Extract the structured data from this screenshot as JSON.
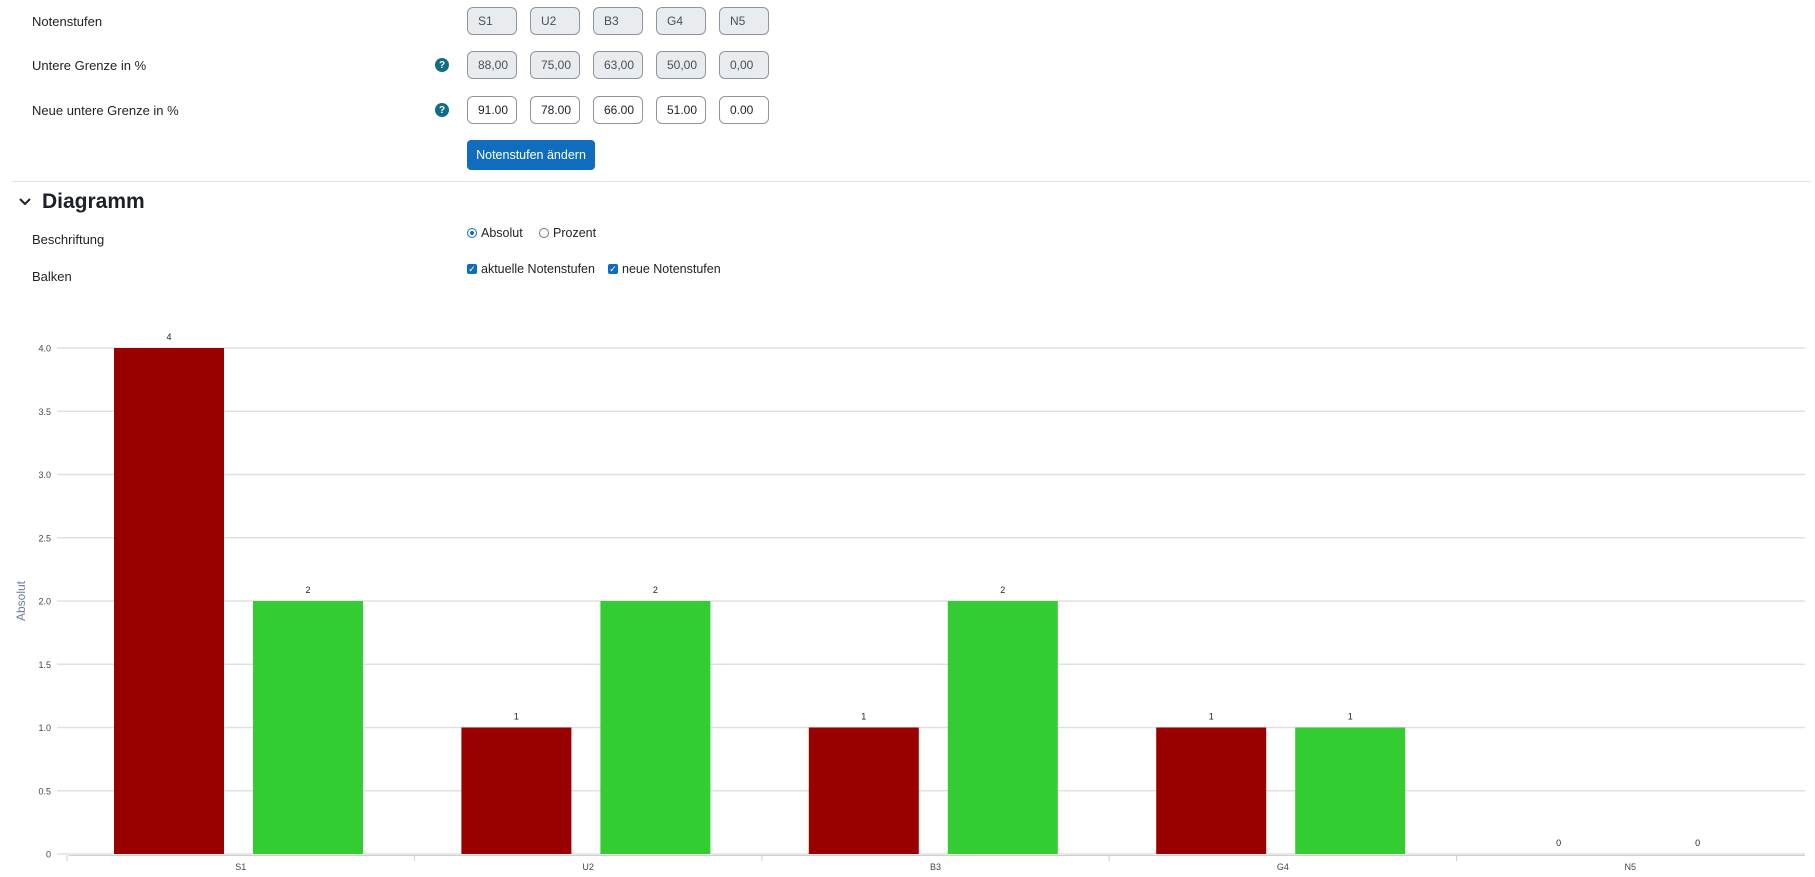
{
  "grades": {
    "levels_label": "Notenstufen",
    "levels": [
      "S1",
      "U2",
      "B3",
      "G4",
      "N5"
    ],
    "lower_label": "Untere Grenze in %",
    "lower": [
      "88,00",
      "75,00",
      "63,00",
      "50,00",
      "0,00"
    ],
    "new_lower_label": "Neue untere Grenze in %",
    "new_lower": [
      "91.00",
      "78.00",
      "66.00",
      "51.00",
      "0.00"
    ],
    "help_icon": "?",
    "change_button": "Notenstufen ändern"
  },
  "diagram": {
    "section_title": "Diagramm",
    "labeling_label": "Beschriftung",
    "labeling_options": [
      {
        "label": "Absolut",
        "selected": true
      },
      {
        "label": "Prozent",
        "selected": false
      }
    ],
    "bars_label": "Balken",
    "bars_options": [
      {
        "label": "aktuelle Notenstufen",
        "checked": true
      },
      {
        "label": "neue Notenstufen",
        "checked": true
      }
    ]
  },
  "chart_data": {
    "type": "bar",
    "categories": [
      "S1",
      "U2",
      "B3",
      "G4",
      "N5"
    ],
    "series": [
      {
        "color": "#990000",
        "values": [
          4,
          1,
          1,
          1,
          0
        ]
      },
      {
        "color": "#33cc33",
        "values": [
          2,
          2,
          2,
          1,
          0
        ]
      }
    ],
    "ylabel": "Absolut",
    "ylim": [
      0,
      4
    ],
    "yticks": [
      "0",
      "0.5",
      "1.0",
      "1.5",
      "2.0",
      "2.5",
      "3.0",
      "3.5",
      "4.0"
    ],
    "grid": true
  }
}
